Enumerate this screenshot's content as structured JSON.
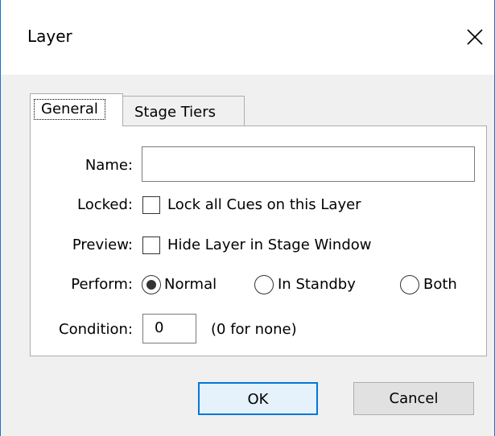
{
  "window": {
    "title": "Layer",
    "accent_color": "#0078d7",
    "close_icon": "close-icon"
  },
  "tabs": [
    {
      "label": "General",
      "selected": true
    },
    {
      "label": "Stage Tiers",
      "selected": false
    }
  ],
  "form": {
    "name_label": "Name:",
    "name_value": "",
    "locked_label": "Locked:",
    "locked_checkbox_label": "Lock all Cues on this Layer",
    "locked_checked": false,
    "preview_label": "Preview:",
    "preview_checkbox_label": "Hide Layer in Stage Window",
    "preview_checked": false,
    "perform_label": "Perform:",
    "perform_options": [
      {
        "label": "Normal",
        "selected": true
      },
      {
        "label": "In Standby",
        "selected": false
      },
      {
        "label": "Both",
        "selected": false
      }
    ],
    "condition_label": "Condition:",
    "condition_value": "0",
    "condition_hint": "(0 for none)"
  },
  "buttons": {
    "ok_label": "OK",
    "cancel_label": "Cancel"
  }
}
